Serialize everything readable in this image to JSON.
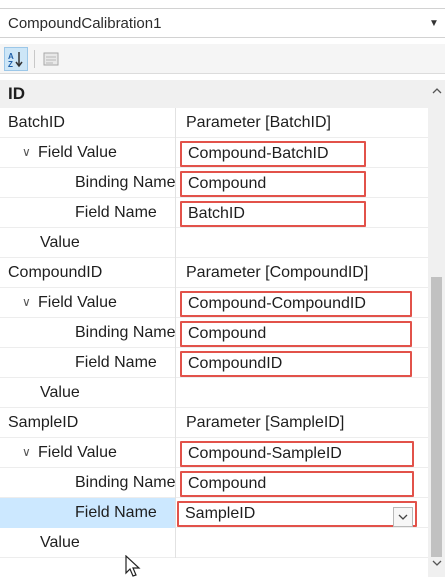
{
  "selector": {
    "object_name": "CompoundCalibration1",
    "dropdown_icon": "caret-down-icon"
  },
  "toolbar": {
    "sort_icon": "sort-alphabetical-icon",
    "pages_icon": "property-pages-icon"
  },
  "category": {
    "label": "ID"
  },
  "rows": [
    {
      "name": "BatchID",
      "value": "Parameter [BatchID]"
    },
    {
      "name": "Field Value",
      "value": "Compound-BatchID"
    },
    {
      "name": "Binding Name",
      "value": "Compound"
    },
    {
      "name": "Field Name",
      "value": "BatchID"
    },
    {
      "name": "Value",
      "value": ""
    },
    {
      "name": "CompoundID",
      "value": "Parameter [CompoundID]"
    },
    {
      "name": "Field Value",
      "value": "Compound-CompoundID"
    },
    {
      "name": "Binding Name",
      "value": "Compound"
    },
    {
      "name": "Field Name",
      "value": "CompoundID"
    },
    {
      "name": "Value",
      "value": ""
    },
    {
      "name": "SampleID",
      "value": "Parameter [SampleID]"
    },
    {
      "name": "Field Value",
      "value": "Compound-SampleID"
    },
    {
      "name": "Binding Name",
      "value": "Compound"
    },
    {
      "name": "Field Name",
      "value": "SampleID"
    },
    {
      "name": "Value",
      "value": ""
    }
  ],
  "colors": {
    "highlight_border": "#e2524a",
    "selected_row": "#cce8ff"
  }
}
